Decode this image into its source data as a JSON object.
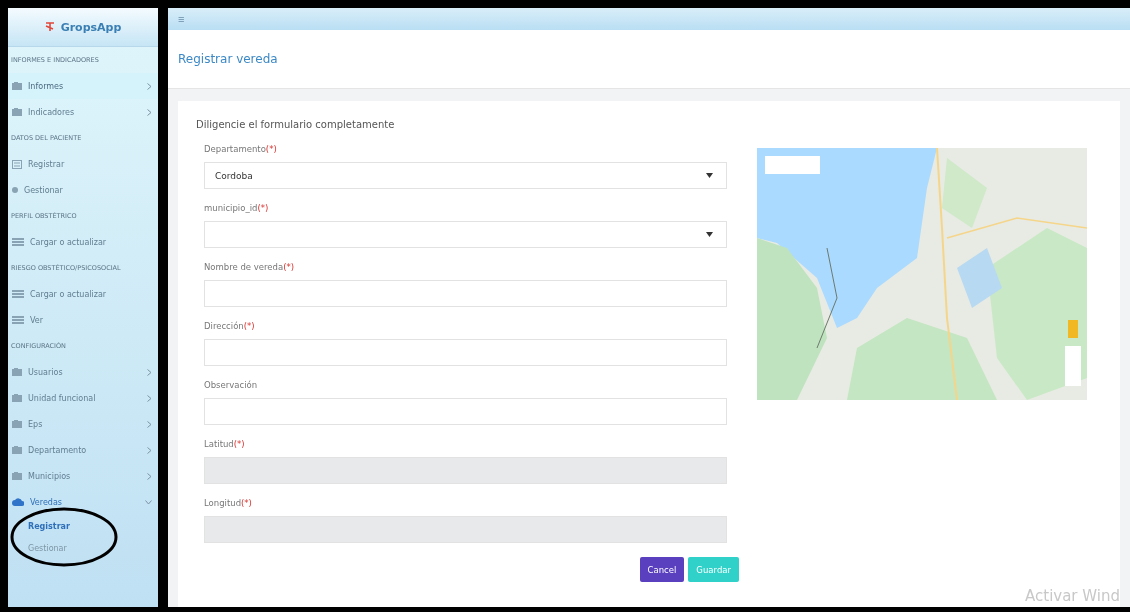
{
  "app": {
    "name": "GropsApp"
  },
  "sidebar": {
    "items": [
      {
        "kind": "section",
        "label": "INFORMES E INDICADORES"
      },
      {
        "kind": "folder",
        "label": "Informes",
        "expanded": false,
        "hovered": true
      },
      {
        "kind": "folder",
        "label": "Indicadores",
        "expanded": false,
        "hovered": false
      },
      {
        "kind": "section",
        "label": "DATOS DEL PACIENTE"
      },
      {
        "kind": "form",
        "label": "Registrar",
        "hovered": false
      },
      {
        "kind": "dot",
        "label": "Gestionar",
        "hovered": false
      },
      {
        "kind": "section",
        "label": "PERFIL OBSTÉTRICO"
      },
      {
        "kind": "list",
        "label": "Cargar o actualizar",
        "hovered": false
      },
      {
        "kind": "section",
        "label": "RIESGO OBSTÉTICO/PSICOSOCIAL"
      },
      {
        "kind": "list",
        "label": "Cargar o actualizar",
        "hovered": false
      },
      {
        "kind": "list",
        "label": "Ver",
        "hovered": false
      },
      {
        "kind": "section",
        "label": "CONFIGURACIÓN"
      },
      {
        "kind": "folder",
        "label": "Usuarios",
        "expanded": false,
        "hovered": false
      },
      {
        "kind": "folder",
        "label": "Unidad funcional",
        "expanded": false,
        "hovered": false
      },
      {
        "kind": "folder",
        "label": "Eps",
        "expanded": false,
        "hovered": false
      },
      {
        "kind": "folder",
        "label": "Departamento",
        "expanded": false,
        "hovered": false
      },
      {
        "kind": "folder",
        "label": "Municipios",
        "expanded": false,
        "hovered": false
      },
      {
        "kind": "cloud",
        "label": "Veredas",
        "expanded": true,
        "hovered": false,
        "children": [
          {
            "label": "Registrar",
            "selected": true
          },
          {
            "label": "Gestionar",
            "selected": false
          }
        ]
      }
    ]
  },
  "topbar": {
    "menu_glyph": "≡"
  },
  "page": {
    "title": "Registrar vereda"
  },
  "form": {
    "heading": "Diligencie el formulario completamente",
    "required_mark": "(*)",
    "fields": [
      {
        "kind": "select",
        "label": "Departamento",
        "required": true,
        "value": "Cordoba"
      },
      {
        "kind": "select",
        "label": "municipio_id",
        "required": true
      },
      {
        "kind": "text",
        "label": "Nombre de vereda",
        "required": true
      },
      {
        "kind": "text",
        "label": "Dirección",
        "required": true
      },
      {
        "kind": "text",
        "label": "Observación",
        "required": false
      },
      {
        "kind": "readonly",
        "label": "Latitud",
        "required": true
      },
      {
        "kind": "readonly",
        "label": "Longitud",
        "required": true
      }
    ],
    "buttons": [
      {
        "kind": "cancel",
        "label": "Cancel"
      },
      {
        "kind": "save",
        "label": "Guardar"
      }
    ]
  },
  "overlay": {
    "text": "Activar Wind"
  }
}
